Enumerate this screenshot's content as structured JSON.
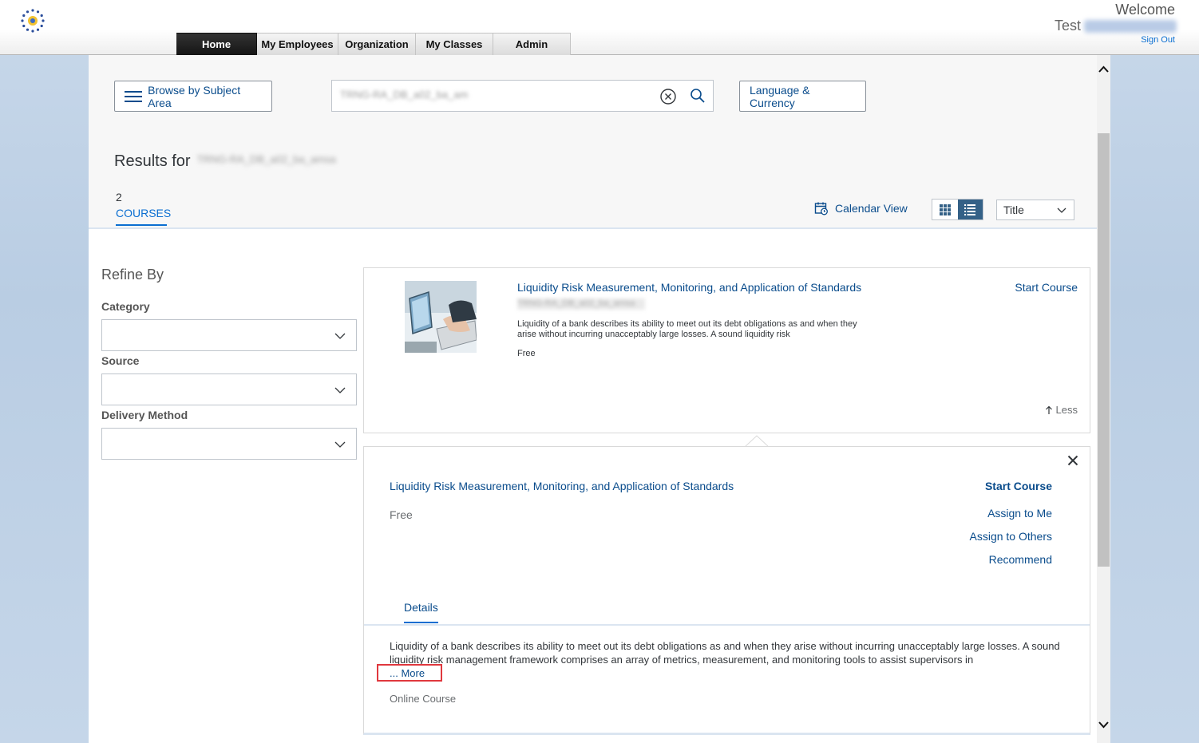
{
  "topbar": {
    "welcome": "Welcome",
    "user_first": "Test",
    "sign_out": "Sign Out",
    "nav": [
      {
        "label": "Home",
        "active": true
      },
      {
        "label": "My Employees",
        "active": false
      },
      {
        "label": "Organization",
        "active": false
      },
      {
        "label": "My Classes",
        "active": false
      },
      {
        "label": "Admin",
        "active": false
      }
    ]
  },
  "toolbar": {
    "browse_label": "Browse by Subject Area",
    "language_label": "Language & Currency",
    "search_value": "TRNG-RA_DB_a02_ba_amsa"
  },
  "results": {
    "prefix": "Results for",
    "query": "TRNG-RA_DB_a02_ba_amsa",
    "count": "2",
    "courses_label": "COURSES",
    "calendar_view": "Calendar View",
    "sort_value": "Title"
  },
  "refine": {
    "title": "Refine By",
    "category_label": "Category",
    "source_label": "Source",
    "delivery_label": "Delivery Method"
  },
  "course": {
    "title": "Liquidity Risk Measurement, Monitoring, and Application of Standards",
    "id": "TRNG-RA_DB_a02_ba_amsa",
    "description": "Liquidity of a bank describes its ability to meet out its debt obligations as and when they arise without incurring unacceptably large losses. A sound liquidity risk",
    "price": "Free",
    "start_label": "Start Course",
    "less_label": "Less"
  },
  "detail": {
    "title": "Liquidity Risk Measurement, Monitoring, and Application of Standards",
    "price": "Free",
    "start_label": "Start Course",
    "assign_me": "Assign to Me",
    "assign_others": "Assign to Others",
    "recommend": "Recommend",
    "tab_details": "Details",
    "description": "Liquidity of a bank describes its ability to meet out its debt obligations as and when they arise without incurring unacceptably large losses. A sound liquidity risk management framework comprises an array of metrics, measurement, and monitoring tools to assist supervisors in",
    "more_label": "... More",
    "delivery_type": "Online Course"
  },
  "colors": {
    "link": "#0a4c8c",
    "accent": "#0a6ed1",
    "highlight": "#e0383e",
    "toggle_active": "#346187"
  },
  "icons": [
    "logo-icon",
    "hamburger-icon",
    "clear-icon",
    "search-icon",
    "calendar-icon",
    "grid-icon",
    "list-icon",
    "chevron-down-icon",
    "arrow-up-icon",
    "close-icon"
  ]
}
